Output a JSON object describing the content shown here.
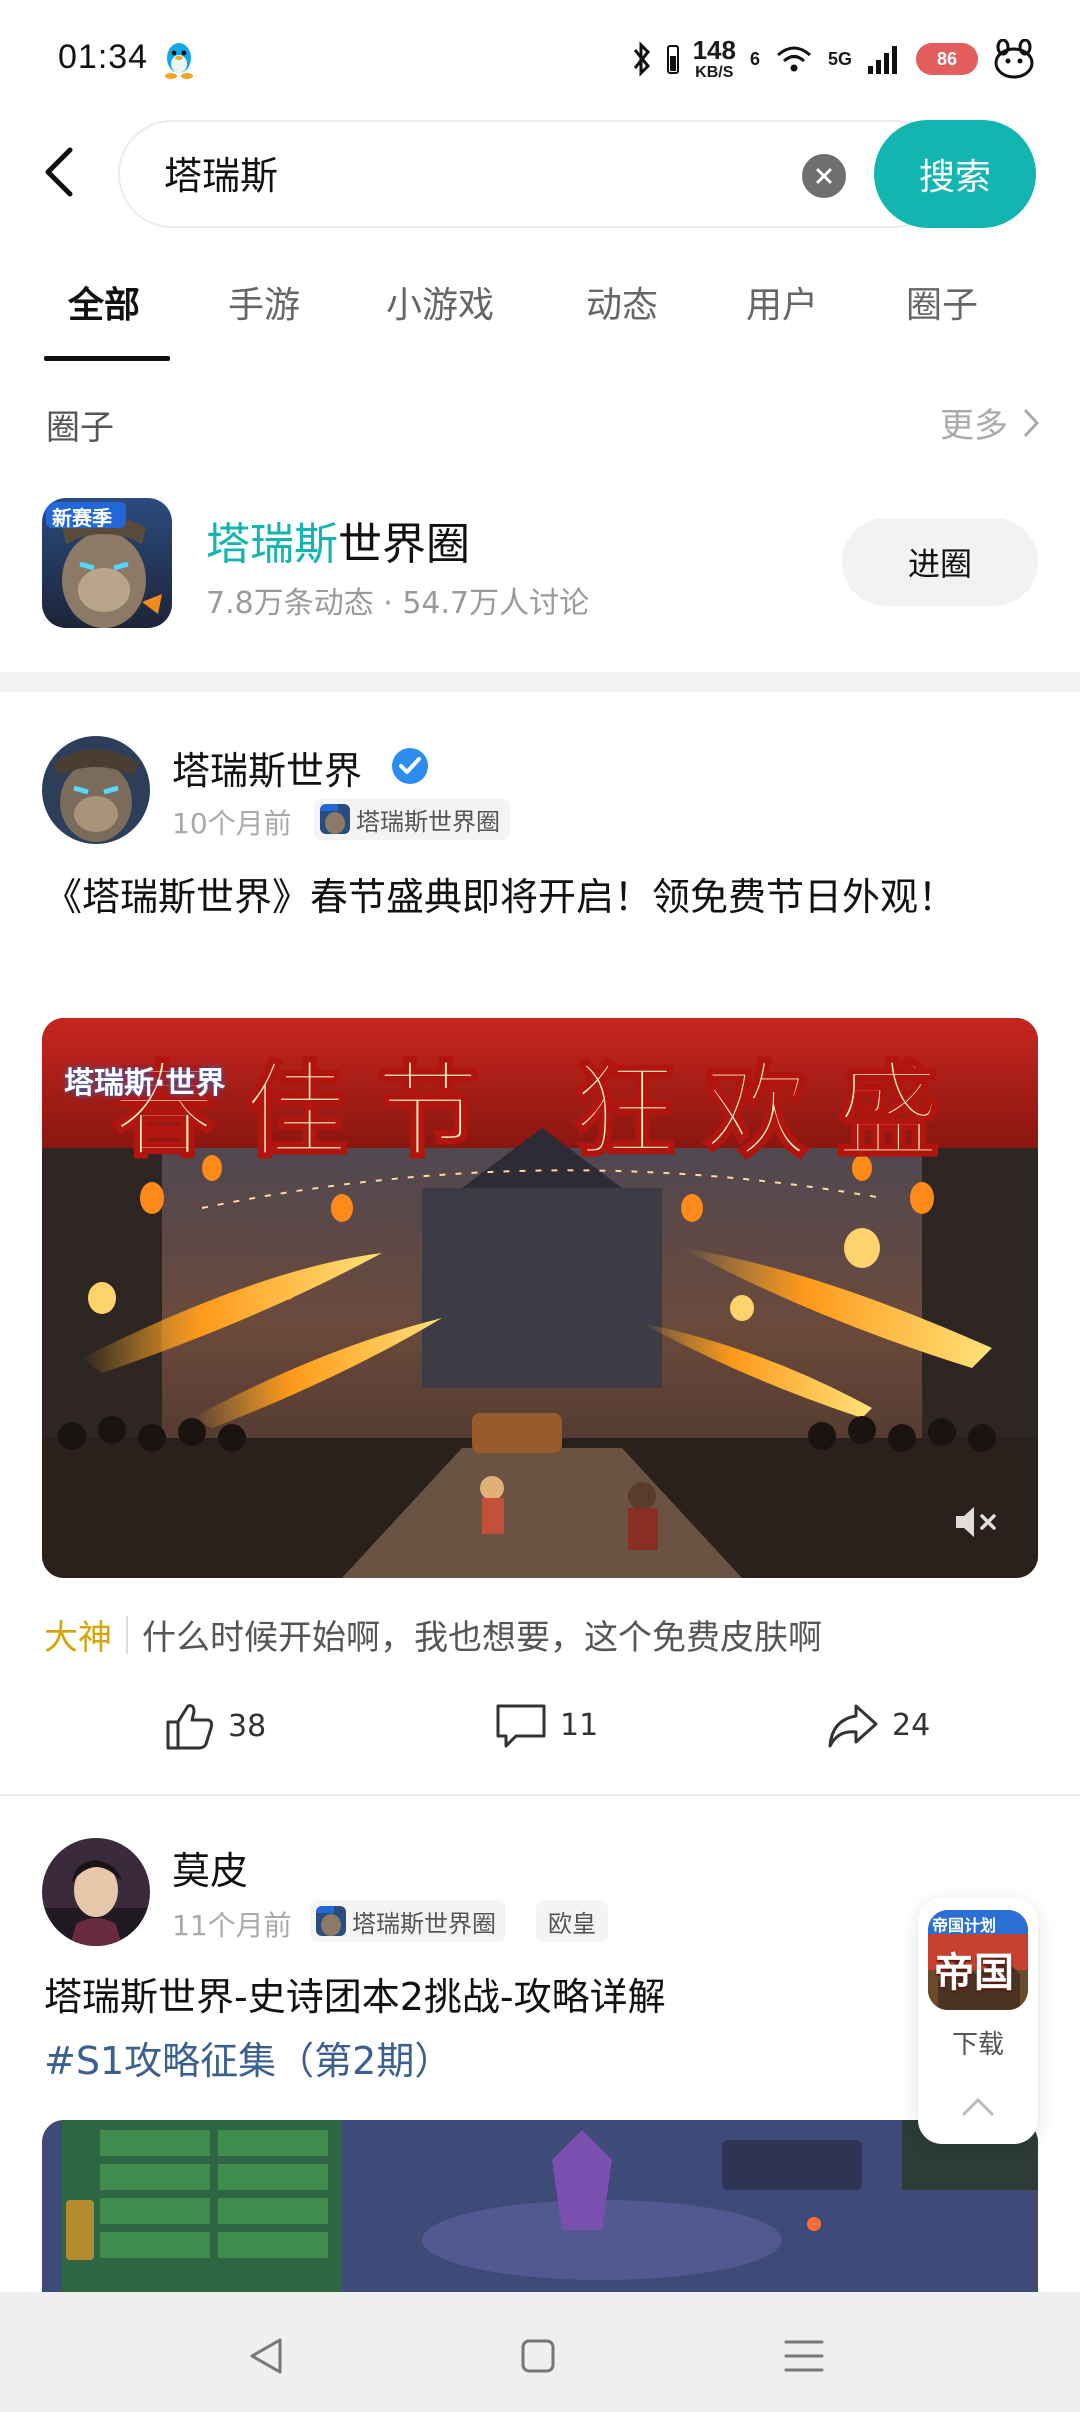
{
  "status_bar": {
    "time": "01:34",
    "net_speed_value": "148",
    "net_speed_unit": "KB/S",
    "signal_label": "5G",
    "sim_index": "6",
    "battery": "86"
  },
  "search": {
    "back_icon": "back-arrow-icon",
    "query": "塔瑞斯",
    "clear_icon": "clear-icon",
    "button_label": "搜索"
  },
  "tabs": [
    {
      "label": "全部",
      "active": true
    },
    {
      "label": "手游",
      "active": false
    },
    {
      "label": "小游戏",
      "active": false
    },
    {
      "label": "动态",
      "active": false
    },
    {
      "label": "用户",
      "active": false
    },
    {
      "label": "圈子",
      "active": false
    }
  ],
  "circle_section": {
    "title": "圈子",
    "more_label": "更多",
    "item": {
      "icon_badge": "新赛季",
      "name_highlight": "塔瑞斯",
      "name_rest": "世界圈",
      "stats": "7.8万条动态 · 54.7万人讨论",
      "join_label": "进圈"
    }
  },
  "posts": [
    {
      "author": "塔瑞斯世界",
      "verified": true,
      "time": "10个月前",
      "circle_chip": "塔瑞斯世界圈",
      "title": "《塔瑞斯世界》春节盛典即将开启！领免费节日外观！",
      "banner_text": "春佳节 狂欢盛",
      "banner_logo": "塔瑞斯·世界",
      "top_comment_badge": "大神",
      "top_comment": "什么时候开始啊，我也想要，这个免费皮肤啊",
      "likes": "38",
      "comments": "11",
      "shares": "24"
    },
    {
      "author": "莫皮",
      "time": "11个月前",
      "circle_chip": "塔瑞斯世界圈",
      "tag_chip": "欧皇",
      "title": "塔瑞斯世界-史诗团本2挑战-攻略详解",
      "hashtag": "#S1攻略征集（第2期）"
    }
  ],
  "float_ad": {
    "icon_text": "帝国",
    "icon_ribbon": "帝国计划",
    "label": "下载"
  },
  "colors": {
    "accent": "#13b5b1",
    "hashtag": "#3b5f8f",
    "badge_gold": "#d7a400"
  }
}
